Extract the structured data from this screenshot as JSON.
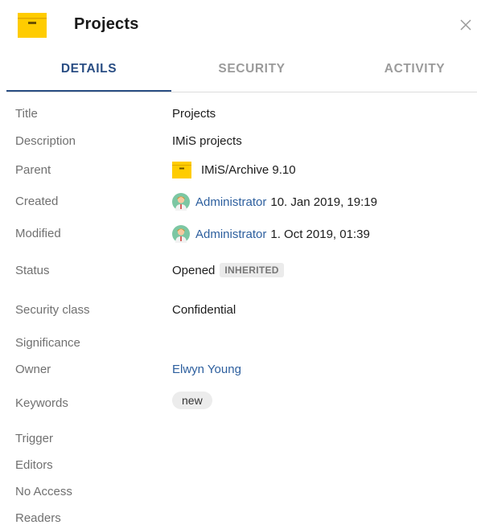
{
  "header": {
    "title": "Projects",
    "folder_icon": "folder-icon",
    "close_icon": "close-icon",
    "folder_color": "#ffcc00"
  },
  "tabs": [
    {
      "label": "DETAILS",
      "active": true
    },
    {
      "label": "SECURITY",
      "active": false
    },
    {
      "label": "ACTIVITY",
      "active": false
    }
  ],
  "details": {
    "title": {
      "label": "Title",
      "value": "Projects"
    },
    "description": {
      "label": "Description",
      "value": "IMiS projects"
    },
    "parent": {
      "label": "Parent",
      "value": "IMiS/Archive 9.10"
    },
    "created": {
      "label": "Created",
      "user": "Administrator",
      "date": "10. Jan 2019, 19:19"
    },
    "modified": {
      "label": "Modified",
      "user": "Administrator",
      "date": "1. Oct 2019, 01:39"
    },
    "status": {
      "label": "Status",
      "value": "Opened",
      "badge": "INHERITED"
    },
    "security_class": {
      "label": "Security class",
      "value": "Confidential"
    },
    "significance": {
      "label": "Significance"
    },
    "owner": {
      "label": "Owner",
      "value": "Elwyn Young"
    },
    "keywords": {
      "label": "Keywords",
      "chips": [
        "new"
      ]
    },
    "trigger": {
      "label": "Trigger"
    },
    "editors": {
      "label": "Editors"
    },
    "no_access": {
      "label": "No Access"
    },
    "readers": {
      "label": "Readers"
    }
  },
  "colors": {
    "accent": "#2a4e84",
    "link": "#2d5f9e",
    "label": "#707070"
  }
}
